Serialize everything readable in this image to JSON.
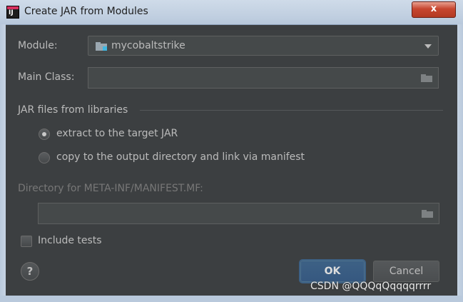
{
  "window": {
    "title": "Create JAR from Modules",
    "close_glyph": "x",
    "app_icon_text": "IJ",
    "app_icon": "intellij-icon"
  },
  "module": {
    "label": "Module:",
    "value": "mycobaltstrike",
    "icon": "module-folder-icon"
  },
  "main_class": {
    "label": "Main Class:",
    "value": "",
    "icon": "folder-icon"
  },
  "jar_files": {
    "section_label": "JAR files from libraries",
    "options": [
      {
        "label": "extract to the target JAR",
        "selected": true
      },
      {
        "label": "copy to the output directory and link via manifest",
        "selected": false
      }
    ]
  },
  "manifest_dir": {
    "label": "Directory for META-INF/MANIFEST.MF:",
    "value": "",
    "icon": "folder-icon"
  },
  "include_tests": {
    "label": "Include tests",
    "checked": false
  },
  "buttons": {
    "help": "?",
    "ok": "OK",
    "cancel": "Cancel"
  },
  "watermark": "CSDN @QQQqQqqqqrrrr",
  "colors": {
    "background": "#3c3f41",
    "field": "#45494a",
    "primary_button": "#365880",
    "text": "#bbbbbb",
    "disabled_text": "#777777"
  }
}
